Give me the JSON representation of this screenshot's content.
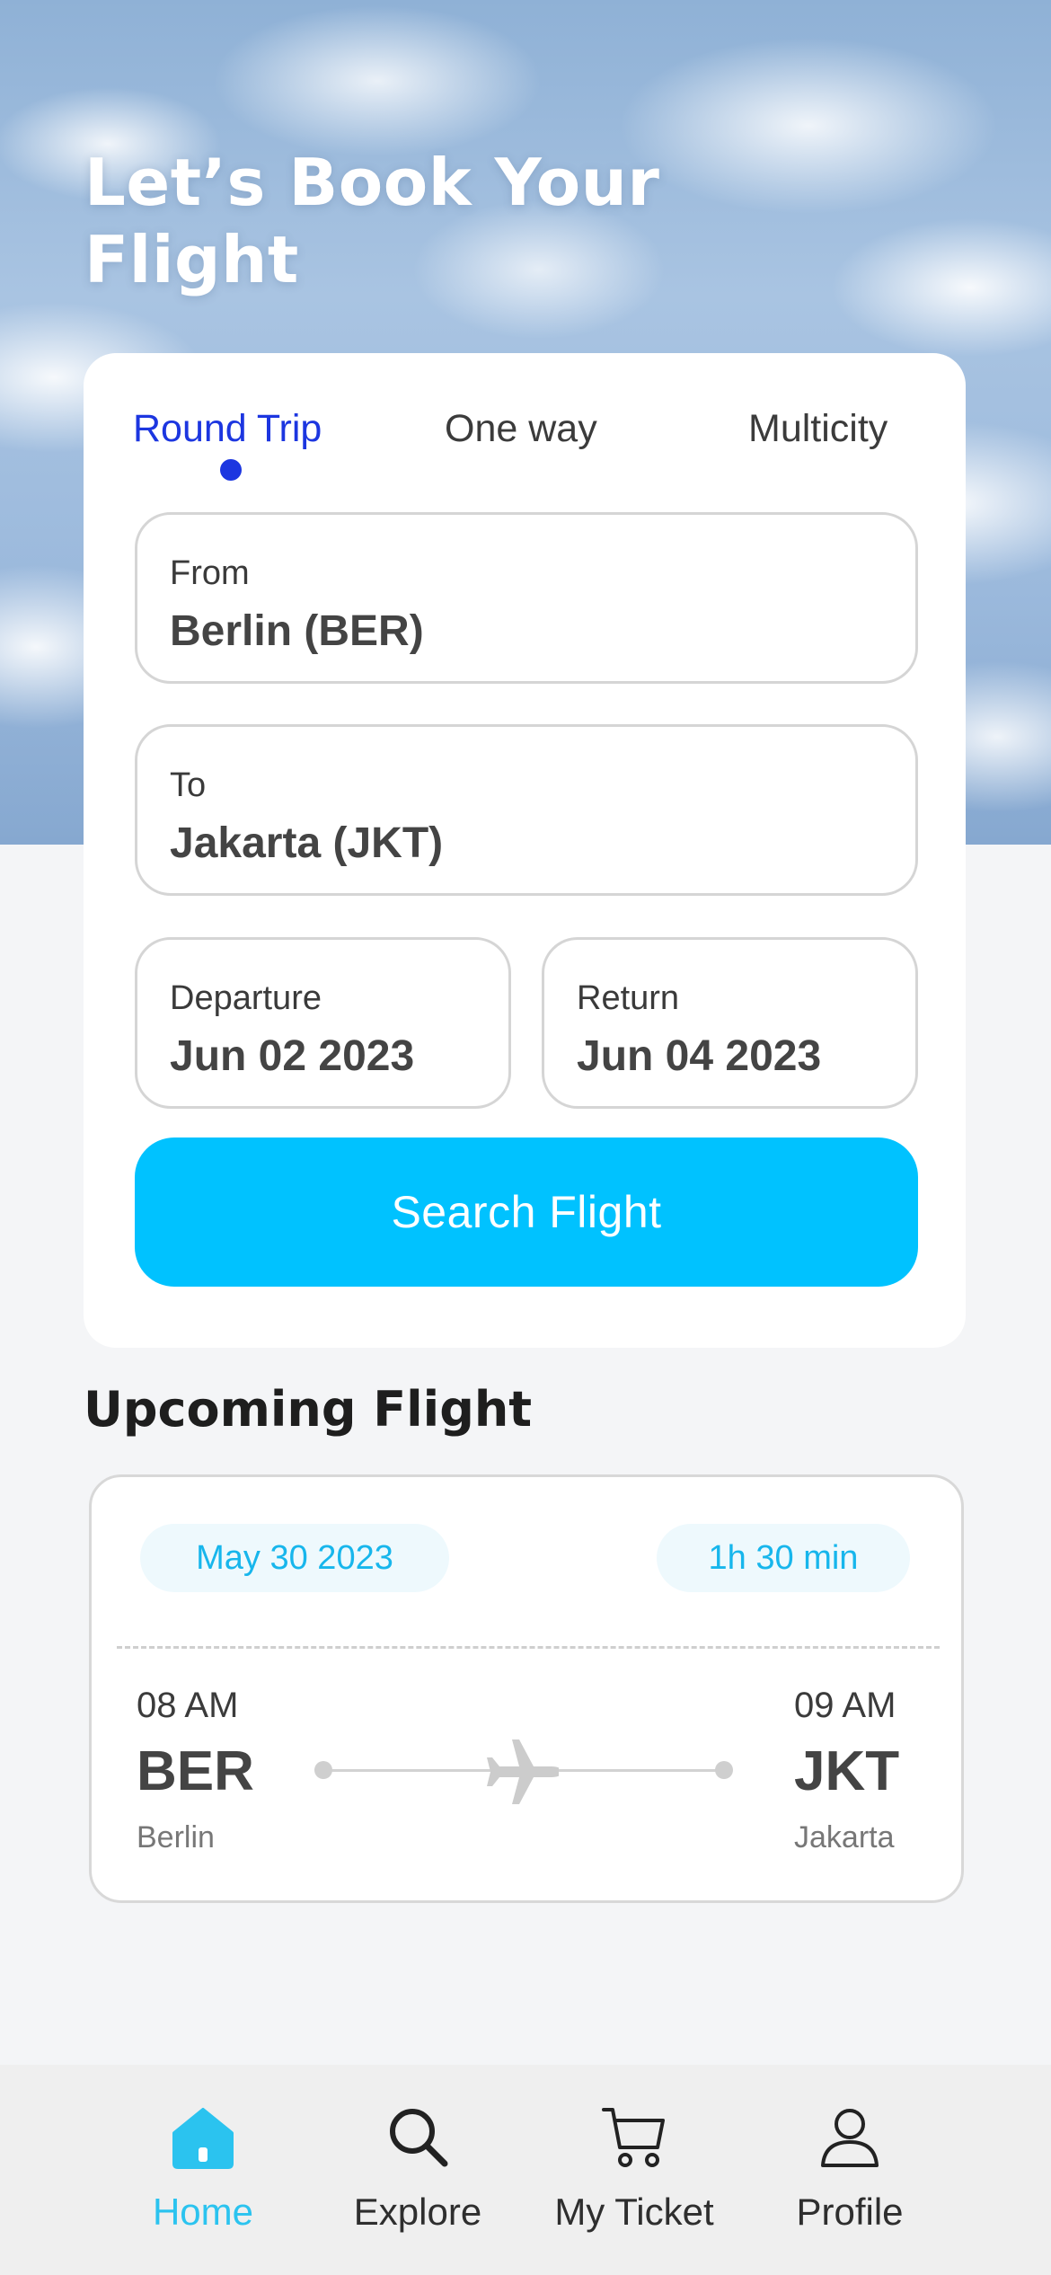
{
  "hero": {
    "title": "Let’s Book Your Flight"
  },
  "booking": {
    "tabs": [
      {
        "label": "Round Trip",
        "active": true
      },
      {
        "label": "One way",
        "active": false
      },
      {
        "label": "Multicity",
        "active": false
      }
    ],
    "from": {
      "label": "From",
      "value": "Berlin (BER)"
    },
    "to": {
      "label": "To",
      "value": "Jakarta (JKT)"
    },
    "departure": {
      "label": "Departure",
      "value": "Jun 02 2023"
    },
    "return": {
      "label": "Return",
      "value": "Jun 04 2023"
    },
    "search_button": "Search Flight"
  },
  "upcoming": {
    "title": "Upcoming Flight",
    "flight": {
      "date": "May 30 2023",
      "duration": "1h 30 min",
      "departure": {
        "time": "08 AM",
        "code": "BER",
        "city": "Berlin"
      },
      "arrival": {
        "time": "09 AM",
        "code": "JKT",
        "city": "Jakarta"
      }
    }
  },
  "nav": {
    "items": [
      {
        "label": "Home",
        "icon": "home-icon",
        "active": true
      },
      {
        "label": "Explore",
        "icon": "search-icon",
        "active": false
      },
      {
        "label": "My Ticket",
        "icon": "cart-icon",
        "active": false
      },
      {
        "label": "Profile",
        "icon": "profile-icon",
        "active": false
      }
    ]
  },
  "colors": {
    "accent_blue": "#1c36e0",
    "button_cyan": "#00c2ff",
    "nav_active": "#2bc3ef",
    "pill_text": "#17b6ec"
  }
}
